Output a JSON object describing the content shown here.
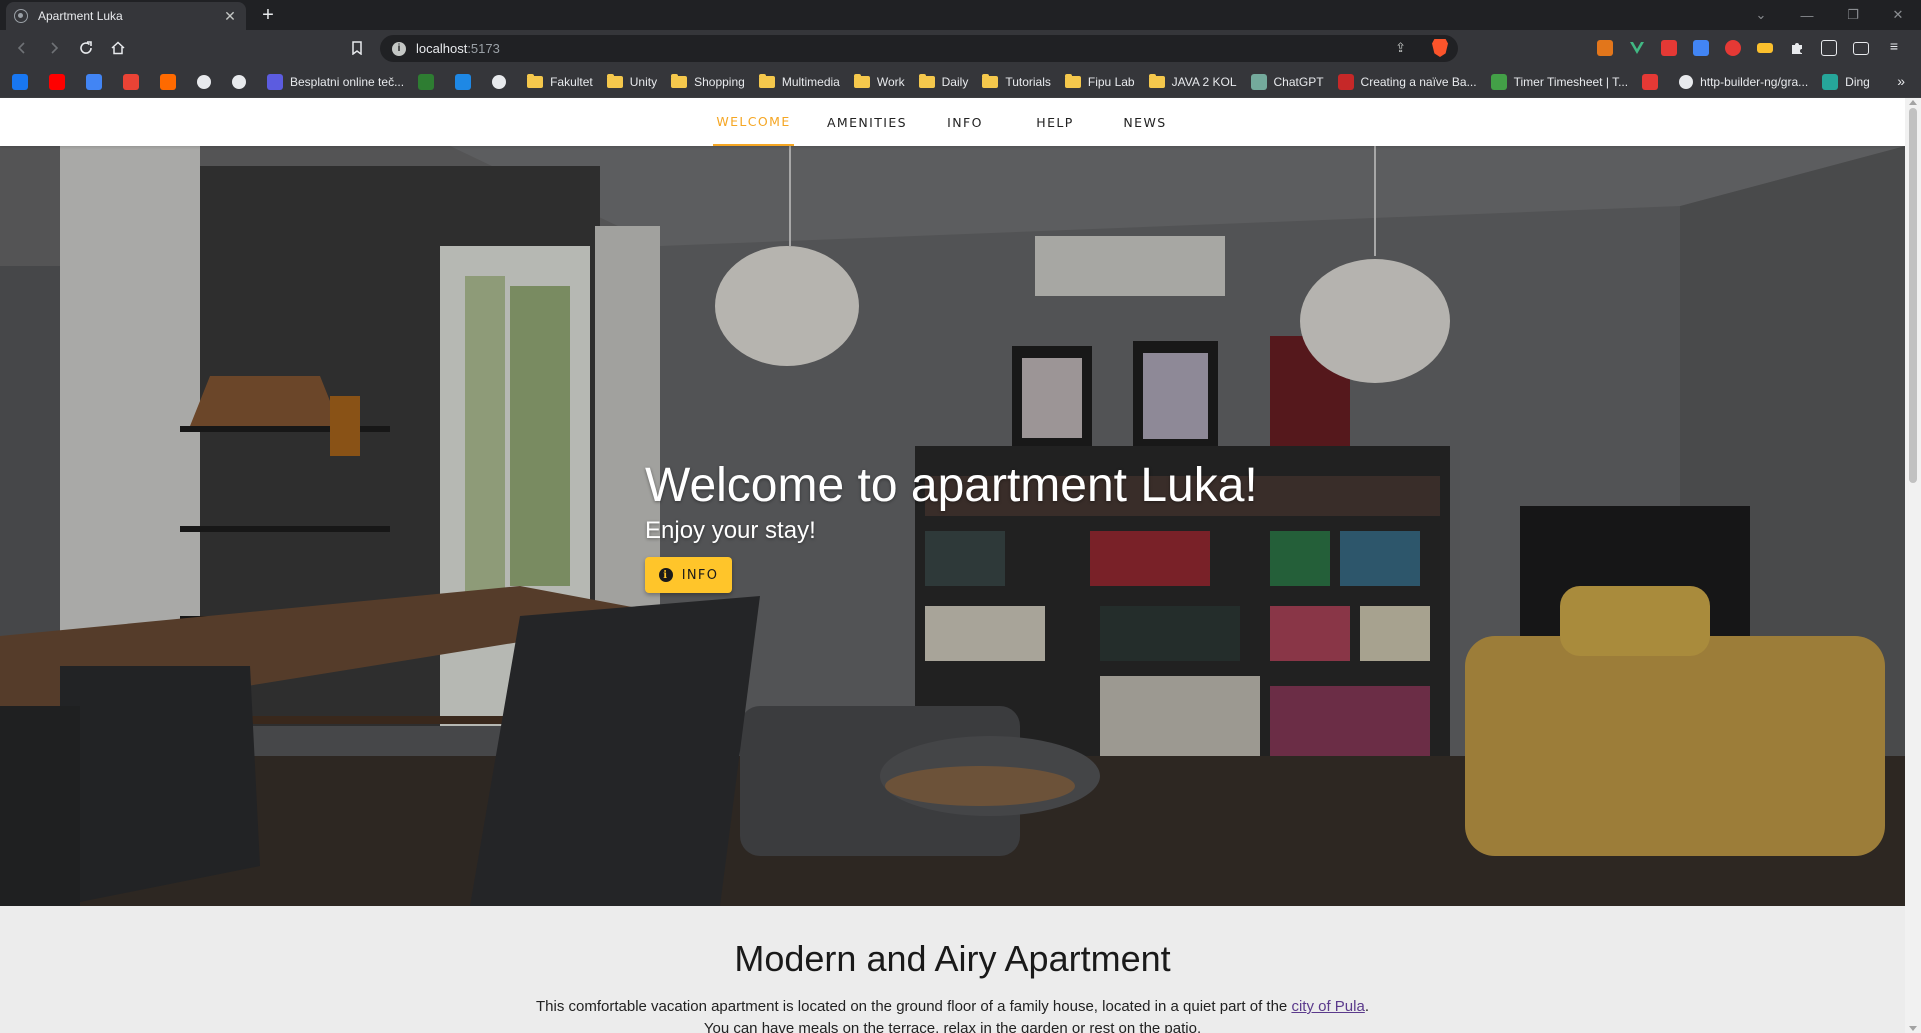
{
  "browser": {
    "tab_title": "Apartment Luka",
    "tab_close": "✕",
    "new_tab": "+",
    "url_host": "localhost",
    "url_port": ":5173",
    "window_controls": [
      "⌄",
      "—",
      "❐",
      "✕"
    ],
    "nav_icons": [
      "arrow-left-icon",
      "arrow-right-icon",
      "reload-icon",
      "home-icon",
      "bookmark-icon"
    ],
    "bookmarks": [
      {
        "label": "",
        "icon": "facebook-icon",
        "color": "#1877f2"
      },
      {
        "label": "",
        "icon": "youtube-icon",
        "color": "#ff0000"
      },
      {
        "label": "",
        "icon": "translate-icon",
        "color": "#4285f4"
      },
      {
        "label": "",
        "icon": "gmail-icon",
        "color": "#ea4335"
      },
      {
        "label": "",
        "icon": "invision-icon",
        "color": "#ff6a00"
      },
      {
        "label": "",
        "icon": "github-icon",
        "color": "#e8eaed"
      },
      {
        "label": "",
        "icon": "terminal-icon",
        "color": "#e8eaed"
      },
      {
        "label": "Besplatni online teč...",
        "icon": "course-icon",
        "color": "#5c5ce0"
      },
      {
        "label": "",
        "icon": "leaf-icon",
        "color": "#2e7d32"
      },
      {
        "label": "",
        "icon": "graduation-icon",
        "color": "#1e88e5"
      },
      {
        "label": "",
        "icon": "notion-icon",
        "color": "#e8eaed"
      },
      {
        "label": "Fakultet",
        "icon": "folder-icon",
        "color": "#f5c84c"
      },
      {
        "label": "Unity",
        "icon": "folder-icon",
        "color": "#f5c84c"
      },
      {
        "label": "Shopping",
        "icon": "folder-icon",
        "color": "#f5c84c"
      },
      {
        "label": "Multimedia",
        "icon": "folder-icon",
        "color": "#f5c84c"
      },
      {
        "label": "Work",
        "icon": "folder-icon",
        "color": "#f5c84c"
      },
      {
        "label": "Daily",
        "icon": "folder-icon",
        "color": "#f5c84c"
      },
      {
        "label": "Tutorials",
        "icon": "folder-icon",
        "color": "#f5c84c"
      },
      {
        "label": "Fipu Lab",
        "icon": "folder-icon",
        "color": "#f5c84c"
      },
      {
        "label": "JAVA 2 KOL",
        "icon": "folder-icon",
        "color": "#f5c84c"
      },
      {
        "label": "ChatGPT",
        "icon": "chatgpt-icon",
        "color": "#74aa9c"
      },
      {
        "label": "Creating a naïve Ba...",
        "icon": "article-icon",
        "color": "#c62828"
      },
      {
        "label": "Timer Timesheet | T...",
        "icon": "timer-icon",
        "color": "#43a047"
      },
      {
        "label": "",
        "icon": "pin-icon",
        "color": "#e53935"
      },
      {
        "label": "http-builder-ng/gra...",
        "icon": "github-icon",
        "color": "#e8eaed"
      },
      {
        "label": "Ding",
        "icon": "ding-icon",
        "color": "#26a69a"
      }
    ],
    "bookmarks_more": "»",
    "extensions": [
      {
        "icon": "metamask-icon",
        "color": "#e2761b"
      },
      {
        "icon": "vue-icon",
        "color": "#41b883"
      },
      {
        "icon": "pdf-icon",
        "color": "#e53935"
      },
      {
        "icon": "translate-icon",
        "color": "#4285f4"
      },
      {
        "icon": "rocket-icon",
        "color": "#e53935"
      },
      {
        "icon": "keyboard-icon",
        "color": "#fbc02d"
      },
      {
        "icon": "puzzle-icon",
        "color": "#e8eaed"
      },
      {
        "icon": "sidebar-icon",
        "color": "#e8eaed"
      },
      {
        "icon": "wallet-icon",
        "color": "#e8eaed"
      },
      {
        "icon": "menu-icon",
        "color": "#e8eaed"
      }
    ]
  },
  "site": {
    "nav": [
      "WELCOME",
      "AMENITIES",
      "INFO",
      "HELP",
      "NEWS"
    ],
    "active_nav": "WELCOME",
    "accent_color": "#f5a623",
    "hero": {
      "title": "Welcome to apartment Luka!",
      "subtitle": "Enjoy your stay!",
      "button_label": "INFO",
      "button_color": "#ffc52a"
    },
    "about": {
      "title": "Modern and Airy Apartment",
      "text_before_link": "This comfortable vacation apartment is located on the ground floor of a family house, located in a quiet part of the ",
      "link_text": "city of Pula",
      "text_after_link": ".",
      "second_line": "You can have meals on the terrace, relax in the garden or rest on the patio."
    }
  }
}
